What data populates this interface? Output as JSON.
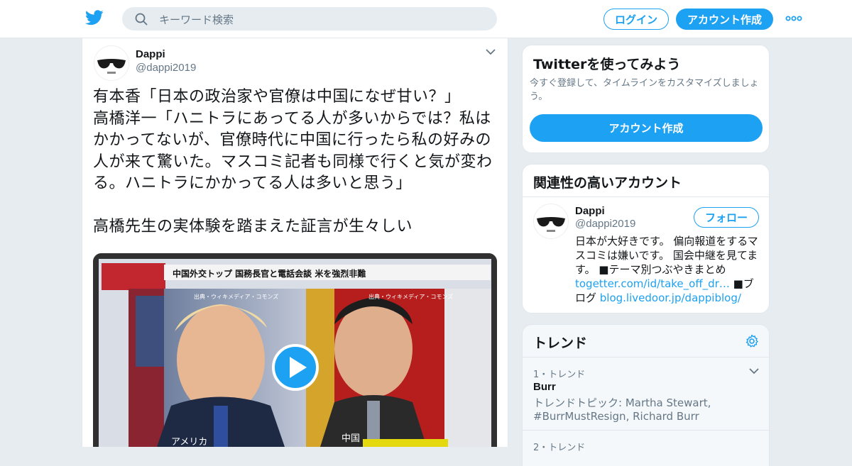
{
  "header": {
    "search_placeholder": "キーワード検索",
    "login_label": "ログイン",
    "signup_label": "アカウント作成",
    "brand_color": "#1da1f2"
  },
  "tweet": {
    "author_name": "Dappi",
    "author_handle": "@dappi2019",
    "text": "有本香「日本の政治家や官僚は中国になぜ甘い？」\n高橋洋一「ハニトラにあってる人が多いからでは？私はかかってないが、官僚時代に中国に行ったら私の好みの人が来て驚いた。マスコミ記者も同様で行くと気が変わる。ハニトラにかかってる人は多いと思う」\n\n高橋先生の実体験を踏まえた証言が生々しい",
    "media": {
      "banner_text": "中国外交トップ 国務長官と電話会談 米を強烈非難",
      "source_left": "出典・ウィキメディア・コモンズ",
      "source_right": "出典・ウィキメディア・コモンズ",
      "caption_left": "アメリカ",
      "caption_right": "中国"
    }
  },
  "sidebar": {
    "try_twitter": {
      "title": "Twitterを使ってみよう",
      "description": "今すぐ登録して、タイムラインをカスタマイズしましょう。",
      "button_label": "アカウント作成"
    },
    "related": {
      "title": "関連性の高いアカウント",
      "account": {
        "name": "Dappi",
        "handle": "@dappi2019",
        "follow_label": "フォロー",
        "bio_text": "日本が大好きです。 偏向報道をするマスコミは嫌いです。 国会中継を見てます。 ■テーマ別つぶやきまとめ ",
        "bio_link1": "togetter.com/id/take_off_dr…",
        "bio_mid": " ■ブログ ",
        "bio_link2": "blog.livedoor.jp/dappiblog/"
      }
    },
    "trends": {
      "title": "トレンド",
      "items": [
        {
          "meta": "1・トレンド",
          "name": "Burr",
          "desc": "トレンドトピック: Martha Stewart, #BurrMustResign, Richard Burr"
        },
        {
          "meta": "2・トレンド"
        }
      ]
    }
  }
}
